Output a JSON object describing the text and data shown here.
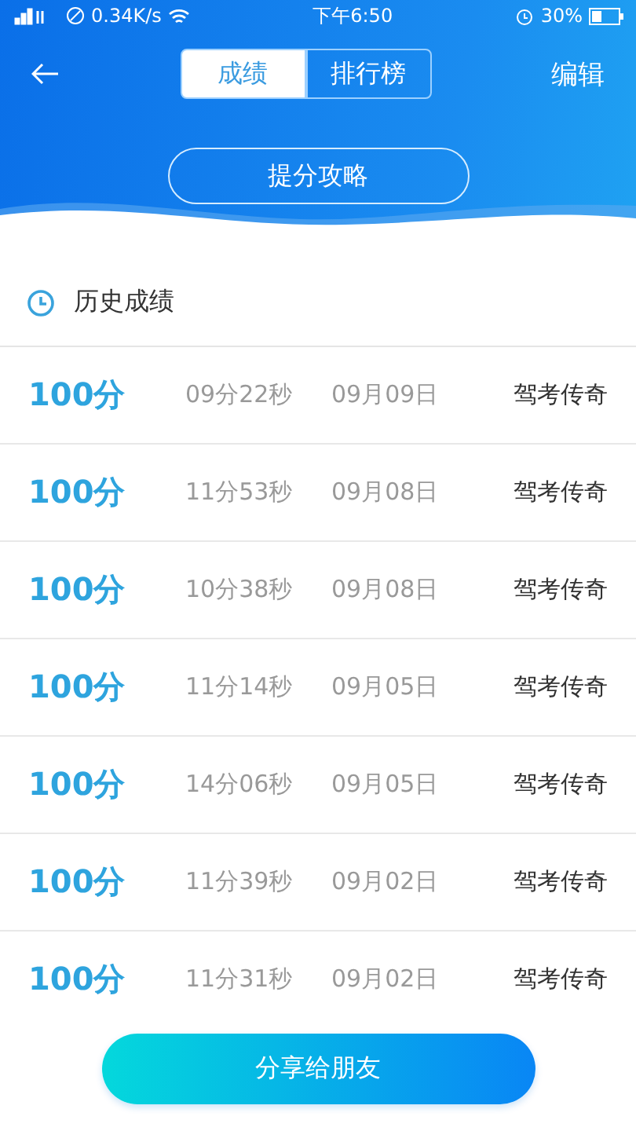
{
  "status_bar": {
    "speed": "0.34K/s",
    "time": "下午6:50",
    "battery": "30%"
  },
  "nav": {
    "tabs": [
      {
        "label": "成绩",
        "selected": true
      },
      {
        "label": "排行榜",
        "selected": false
      }
    ],
    "action": "编辑"
  },
  "tips_button": "提分攻略",
  "section_title": "历史成绩",
  "records": [
    {
      "score": "100分",
      "duration": "09分22秒",
      "date": "09月09日",
      "title": "驾考传奇"
    },
    {
      "score": "100分",
      "duration": "11分53秒",
      "date": "09月08日",
      "title": "驾考传奇"
    },
    {
      "score": "100分",
      "duration": "10分38秒",
      "date": "09月08日",
      "title": "驾考传奇"
    },
    {
      "score": "100分",
      "duration": "11分14秒",
      "date": "09月05日",
      "title": "驾考传奇"
    },
    {
      "score": "100分",
      "duration": "14分06秒",
      "date": "09月05日",
      "title": "驾考传奇"
    },
    {
      "score": "100分",
      "duration": "11分39秒",
      "date": "09月02日",
      "title": "驾考传奇"
    },
    {
      "score": "100分",
      "duration": "11分31秒",
      "date": "09月02日",
      "title": "驾考传奇"
    }
  ],
  "share_button": "分享给朋友"
}
